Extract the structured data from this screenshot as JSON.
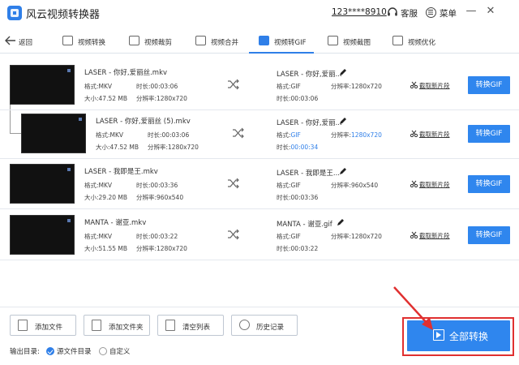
{
  "titlebar": {
    "app_title": "风云视频转换器",
    "user_id": "123****8910",
    "support_label": "客服",
    "menu_label": "菜单",
    "minimize": "—",
    "close": "✕"
  },
  "nav": {
    "back_label": "返回",
    "items": [
      {
        "label": "视频转换",
        "icon": "video-convert-icon"
      },
      {
        "label": "视频裁剪",
        "icon": "video-crop-icon"
      },
      {
        "label": "视频合并",
        "icon": "video-merge-icon"
      },
      {
        "label": "视频转GIF",
        "icon": "gif-icon",
        "active": true
      },
      {
        "label": "视频截图",
        "icon": "screenshot-icon"
      },
      {
        "label": "视频优化",
        "icon": "optimize-icon"
      }
    ]
  },
  "labels": {
    "format": "格式:",
    "size": "大小:",
    "duration": "时长:",
    "resolution": "分辨率:",
    "trim": "截取新片段",
    "convert": "转换GIF"
  },
  "files": [
    {
      "src_name": "LASER - 你好,爱丽丝.mkv",
      "src_format": "MKV",
      "src_duration": "00:03:06",
      "src_size": "47.52 MB",
      "src_resolution": "1280x720",
      "dst_name": "LASER - 你好,爱丽...",
      "dst_format": "GIF",
      "dst_resolution": "1280x720",
      "dst_duration": "00:03:06"
    },
    {
      "src_name": "LASER - 你好,爱丽丝 (5).mkv",
      "src_format": "MKV",
      "src_duration": "00:03:06",
      "src_size": "47.52 MB",
      "src_resolution": "1280x720",
      "dst_name": "LASER - 你好,爱丽...",
      "dst_format": "GIF",
      "dst_resolution": "1280x720",
      "dst_duration": "00:00:34"
    },
    {
      "src_name": "LASER - 我即是王.mkv",
      "src_format": "MKV",
      "src_duration": "00:03:36",
      "src_size": "29.20 MB",
      "src_resolution": "960x540",
      "dst_name": "LASER - 我即是王...",
      "dst_format": "GIF",
      "dst_resolution": "960x540",
      "dst_duration": "00:03:36"
    },
    {
      "src_name": "MANTA - 谢亚.mkv",
      "src_format": "MKV",
      "src_duration": "00:03:22",
      "src_size": "51.55 MB",
      "src_resolution": "1280x720",
      "dst_name": "MANTA - 谢亚.gif",
      "dst_format": "GIF",
      "dst_resolution": "1280x720",
      "dst_duration": "00:03:22"
    }
  ],
  "toolbar": {
    "add_file": "添加文件",
    "add_folder": "添加文件夹",
    "clear_list": "清空列表",
    "history": "历史记录",
    "convert_all": "全部转换"
  },
  "output": {
    "label": "输出目录:",
    "option_source": "源文件目录",
    "option_custom": "自定义"
  },
  "colors": {
    "accent": "#2f86ee",
    "highlight": "#e03030"
  }
}
